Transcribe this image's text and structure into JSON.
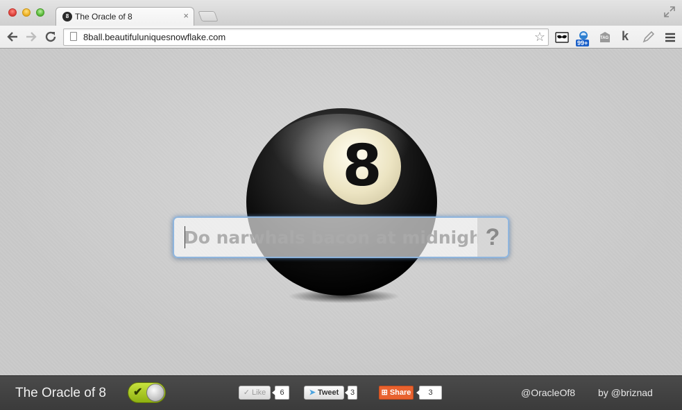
{
  "browser": {
    "tab": {
      "title": "The Oracle of 8",
      "favicon": "8",
      "close": "×"
    },
    "address": {
      "url": "8ball.beautifuluniquesnowflake.com"
    },
    "extension_badge": "99+",
    "extension_tag_label": "TAG",
    "extension_k_label": "k"
  },
  "main": {
    "ball_number": "8",
    "question": {
      "placeholder": "Do narwhals bacon at midnight",
      "value": "",
      "ask_label": "?"
    }
  },
  "footer": {
    "site_name": "The Oracle of 8",
    "toggle_on": true,
    "like": {
      "label": "Like",
      "count": "6"
    },
    "tweet": {
      "label": "Tweet",
      "count": "3"
    },
    "share": {
      "label": "Share",
      "count": "3"
    },
    "twitter_handle": "@OracleOf8",
    "author": "by @briznad"
  },
  "colors": {
    "toggle": "#a6c920",
    "share": "#e8622f",
    "footer_bg": "#3f3f3f",
    "input_border": "#8fb5dd"
  }
}
